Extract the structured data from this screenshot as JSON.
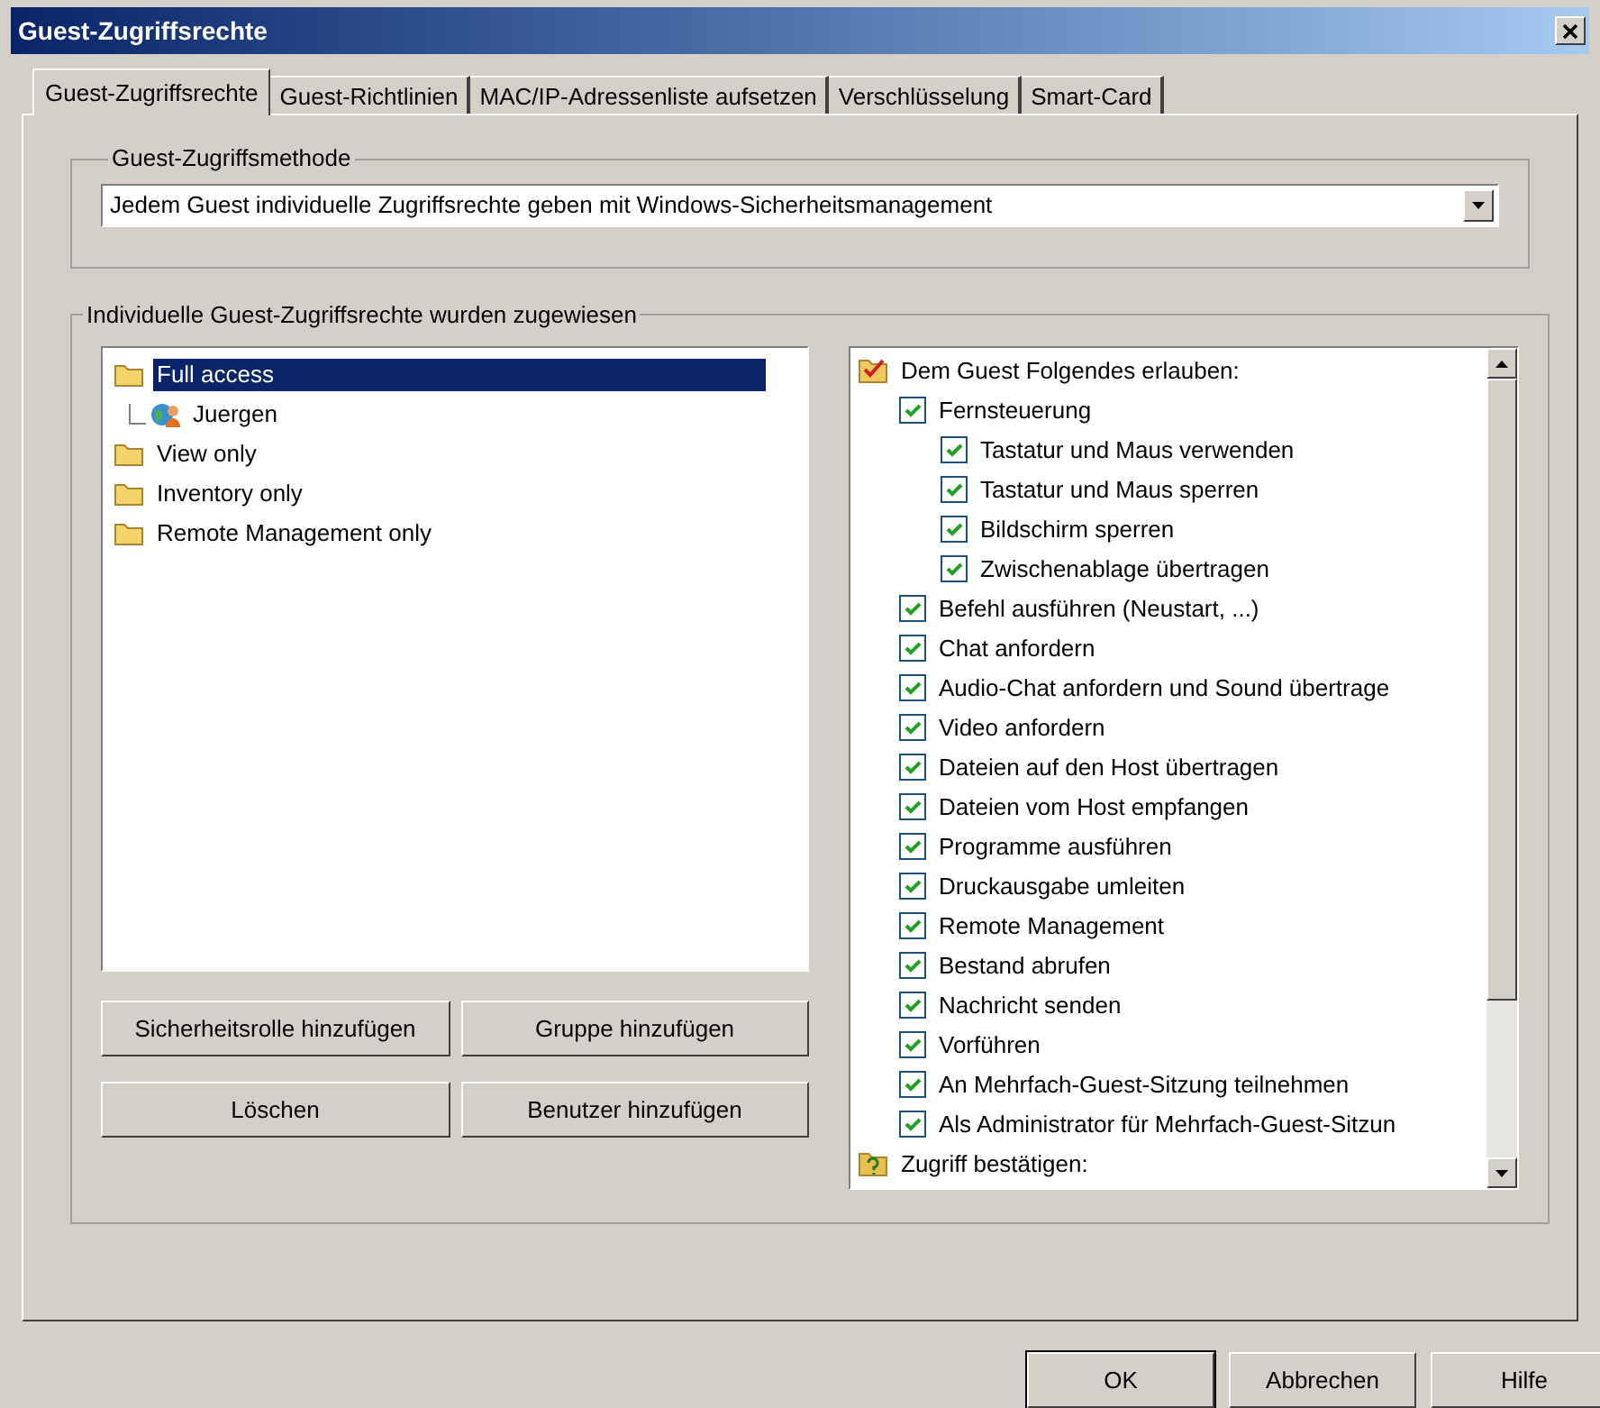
{
  "window": {
    "title": "Guest-Zugriffsrechte"
  },
  "tabs": [
    {
      "label": "Guest-Zugriffsrechte",
      "selected": true
    },
    {
      "label": "Guest-Richtlinien",
      "selected": false
    },
    {
      "label": "MAC/IP-Adressenliste aufsetzen",
      "selected": false
    },
    {
      "label": "Verschlüsselung",
      "selected": false
    },
    {
      "label": "Smart-Card",
      "selected": false
    }
  ],
  "access_method": {
    "title": "Guest-Zugriffsmethode",
    "value": "Jedem Guest individuelle Zugriffsrechte geben mit Windows-Sicherheitsmanagement"
  },
  "assignment": {
    "title": "Individuelle Guest-Zugriffsrechte wurden zugewiesen",
    "tree": [
      {
        "label": "Full access",
        "kind": "folder",
        "selected": true,
        "children": [
          {
            "label": "Juergen",
            "kind": "user",
            "selected": false
          }
        ]
      },
      {
        "label": "View only",
        "kind": "folder",
        "selected": false
      },
      {
        "label": "Inventory only",
        "kind": "folder",
        "selected": false
      },
      {
        "label": "Remote Management only",
        "kind": "folder",
        "selected": false
      }
    ],
    "buttons": [
      "Sicherheitsrolle hinzufügen",
      "Gruppe hinzufügen",
      "Löschen",
      "Benutzer hinzufügen"
    ],
    "permissions": [
      {
        "label": "Dem Guest Folgendes erlauben:",
        "kind": "allow",
        "children": [
          {
            "label": "Fernsteuerung",
            "kind": "check",
            "checked": true,
            "children": [
              {
                "label": "Tastatur und Maus verwenden",
                "kind": "check",
                "checked": true
              },
              {
                "label": "Tastatur und Maus sperren",
                "kind": "check",
                "checked": true
              },
              {
                "label": "Bildschirm sperren",
                "kind": "check",
                "checked": true
              },
              {
                "label": "Zwischenablage übertragen",
                "kind": "check",
                "checked": true
              }
            ]
          },
          {
            "label": "Befehl ausführen (Neustart, ...)",
            "kind": "check",
            "checked": true
          },
          {
            "label": "Chat anfordern",
            "kind": "check",
            "checked": true
          },
          {
            "label": "Audio-Chat anfordern und Sound übertrage",
            "kind": "check",
            "checked": true
          },
          {
            "label": "Video anfordern",
            "kind": "check",
            "checked": true
          },
          {
            "label": "Dateien auf den Host übertragen",
            "kind": "check",
            "checked": true
          },
          {
            "label": "Dateien vom Host empfangen",
            "kind": "check",
            "checked": true
          },
          {
            "label": "Programme ausführen",
            "kind": "check",
            "checked": true
          },
          {
            "label": "Druckausgabe umleiten",
            "kind": "check",
            "checked": true
          },
          {
            "label": "Remote Management",
            "kind": "check",
            "checked": true
          },
          {
            "label": "Bestand abrufen",
            "kind": "check",
            "checked": true
          },
          {
            "label": "Nachricht senden",
            "kind": "check",
            "checked": true
          },
          {
            "label": "Vorführen",
            "kind": "check",
            "checked": true
          },
          {
            "label": "An Mehrfach-Guest-Sitzung teilnehmen",
            "kind": "check",
            "checked": true
          },
          {
            "label": "Als Administrator für Mehrfach-Guest-Sitzun",
            "kind": "check",
            "checked": true
          }
        ]
      },
      {
        "label": "Zugriff bestätigen:",
        "kind": "confirm"
      }
    ]
  },
  "dialog_buttons": [
    {
      "label": "OK",
      "default": true
    },
    {
      "label": "Abbrechen",
      "default": false
    },
    {
      "label": "Hilfe",
      "default": false
    }
  ]
}
